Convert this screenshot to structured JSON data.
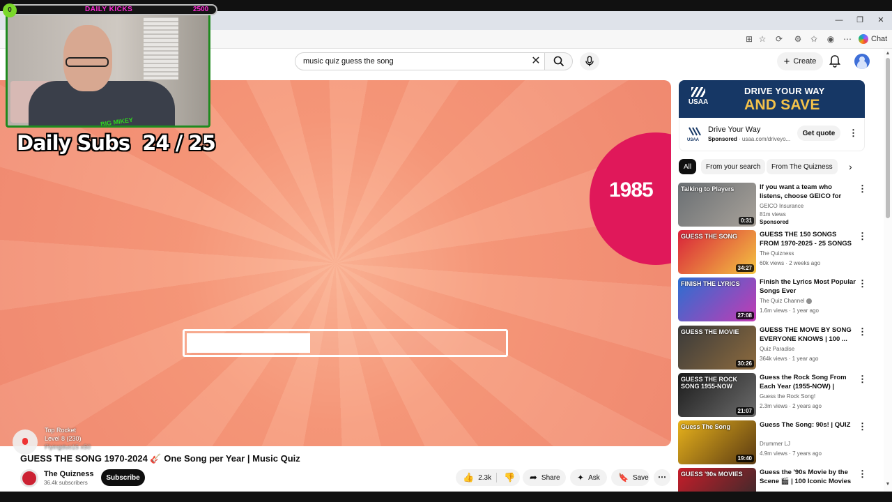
{
  "search": {
    "query": "music quiz guess the song"
  },
  "header": {
    "create_label": "Create"
  },
  "browser": {
    "chat_label": "Chat"
  },
  "overlay": {
    "cam_badge": "0",
    "daily_kicks_label": "DAILY KICKS",
    "daily_kicks_count": "2500",
    "cam_logo_text": "BIG MIKEY",
    "daily_subs": "Daily Subs  24 / 25",
    "rocket": {
      "name": "Top Rocket",
      "level": "Level 8  (230)",
      "faded": "Flyingduo15 x50"
    }
  },
  "player": {
    "year": "1985",
    "progress": 0.39
  },
  "video": {
    "title": "GUESS THE SONG 1970-2024 🎸 One Song per Year | Music Quiz",
    "channel": "The Quizness",
    "subscribers": "36.4k subscribers",
    "subscribe_label": "Subscribe",
    "likes": "2.3k",
    "share_label": "Share",
    "ask_label": "Ask",
    "save_label": "Save"
  },
  "ad": {
    "banner_brand": "USAA",
    "banner_line1": "DRIVE YOUR WAY",
    "banner_line2": "AND SAVE",
    "title": "Drive Your Way",
    "sponsored": "Sponsored",
    "url": "usaa.com/driveyo...",
    "cta": "Get quote"
  },
  "chips": [
    "All",
    "From your search",
    "From The Quizness"
  ],
  "recommendations": [
    {
      "title": "If you want a team who listens, choose GEICO for phenomenal...",
      "channel": "GEICO Insurance",
      "meta": "81m views",
      "extra": "Sponsored",
      "duration": "0:31",
      "thumb_text": "Talking to Players",
      "thumb_bg": "#6a6f73",
      "thumb_bg2": "#a8a29a"
    },
    {
      "title": "GUESS THE 150 SONGS FROM 1970-2025 - 25 SONGS PER ...",
      "channel": "The Quizness",
      "meta": "60k views · 2 weeks ago",
      "extra": "",
      "duration": "34:27",
      "thumb_text": "GUESS THE SONG",
      "thumb_bg": "#d8213a",
      "thumb_bg2": "#f4c542"
    },
    {
      "title": "Finish the Lyrics Most Popular Songs Ever",
      "channel": "The Quiz Channel",
      "meta": "1.6m views · 1 year ago",
      "extra": "",
      "duration": "27:08",
      "thumb_text": "FINISH THE LYRICS",
      "thumb_bg": "#2a6fd1",
      "thumb_bg2": "#c43bb4"
    },
    {
      "title": "GUESS THE MOVE BY SONG EVERYONE KNOWS | 100 ...",
      "channel": "Quiz Paradise",
      "meta": "364k views · 1 year ago",
      "extra": "",
      "duration": "30:26",
      "thumb_text": "GUESS THE MOVIE",
      "thumb_bg": "#3a3a3a",
      "thumb_bg2": "#8d6b3e"
    },
    {
      "title": "Guess the Rock Song From Each Year (1955-NOW) | Musi...",
      "channel": "Guess the Rock Song!",
      "meta": "2.3m views · 2 years ago",
      "extra": "",
      "duration": "21:07",
      "thumb_text": "GUESS THE ROCK SONG 1955-NOW",
      "thumb_bg": "#1b1b1b",
      "thumb_bg2": "#6c6c6c"
    },
    {
      "title": "Guess The Song: 90s! | QUIZ",
      "channel": "Drummer LJ",
      "meta": "4.9m views · 7 years ago",
      "extra": "",
      "duration": "19:40",
      "thumb_text": "Guess The Song",
      "thumb_bg": "#e7b21c",
      "thumb_bg2": "#5a3a12"
    },
    {
      "title": "Guess the '90s Movie by the Scene 🎬 | 100 Iconic Movies ...",
      "channel": "",
      "meta": "",
      "extra": "",
      "duration": "",
      "thumb_text": "GUESS '90s MOVIES",
      "thumb_bg": "#c81d2a",
      "thumb_bg2": "#2b2b2b"
    }
  ]
}
